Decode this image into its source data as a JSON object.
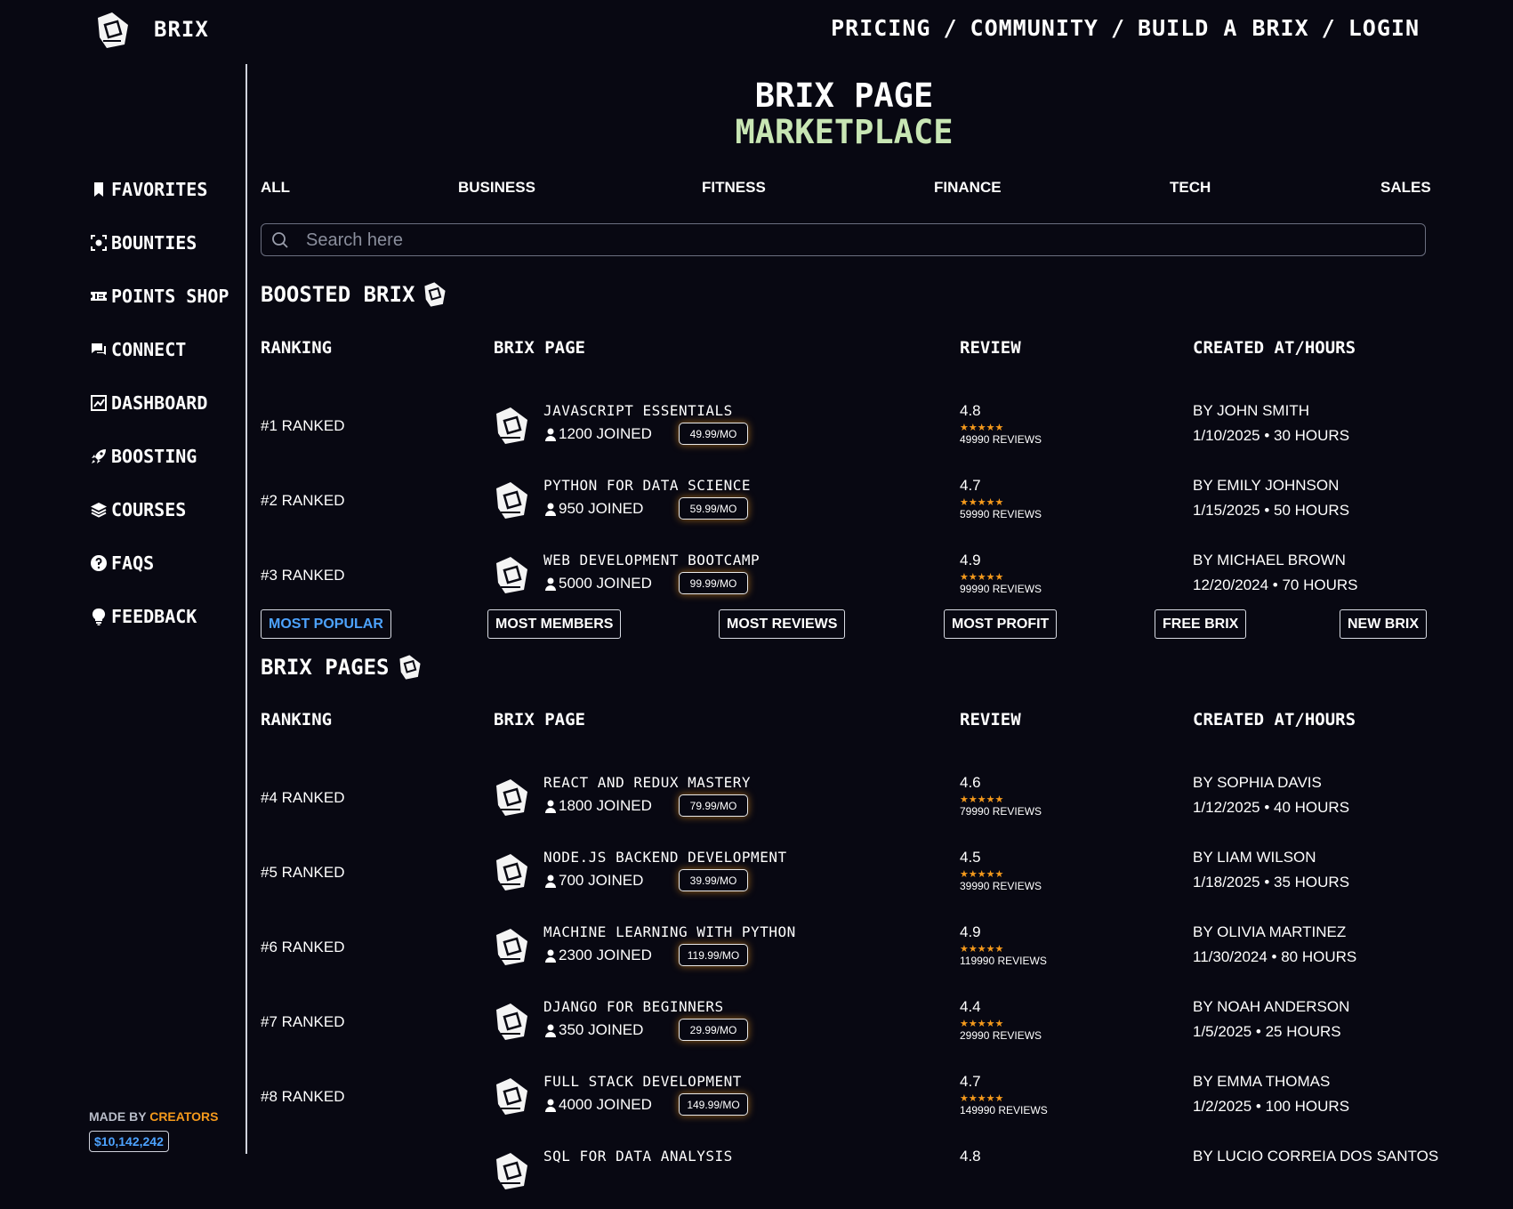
{
  "header": {
    "brand": "BRIX",
    "nav": [
      "PRICING",
      "COMMUNITY",
      "BUILD A BRIX",
      "LOGIN"
    ],
    "separator": "/"
  },
  "sidebar": {
    "items": [
      {
        "label": "FAVORITES",
        "icon": "bookmark-icon"
      },
      {
        "label": "BOUNTIES",
        "icon": "target-icon"
      },
      {
        "label": "POINTS SHOP",
        "icon": "ticket-icon"
      },
      {
        "label": "CONNECT",
        "icon": "chat-icon"
      },
      {
        "label": "DASHBOARD",
        "icon": "chart-icon"
      },
      {
        "label": "BOOSTING",
        "icon": "rocket-icon"
      },
      {
        "label": "COURSES",
        "icon": "layers-icon"
      },
      {
        "label": "FAQS",
        "icon": "question-icon"
      },
      {
        "label": "FEEDBACK",
        "icon": "lightbulb-icon"
      }
    ],
    "made_by_prefix": "MADE BY",
    "made_by_accent": "CREATORS",
    "total": "$10,142,242"
  },
  "page": {
    "title": "BRIX PAGE",
    "subtitle": "MARKETPLACE"
  },
  "tabs": [
    "ALL",
    "BUSINESS",
    "FITNESS",
    "FINANCE",
    "TECH",
    "SALES"
  ],
  "search": {
    "placeholder": "Search here",
    "value": ""
  },
  "columns": [
    "RANKING",
    "BRIX PAGE",
    "REVIEW",
    "CREATED AT/HOURS"
  ],
  "boosted": {
    "title": "BOOSTED BRIX",
    "rows": [
      {
        "rank": "#1 RANKED",
        "name": "JAVASCRIPT ESSENTIALS",
        "joined": "1200 JOINED",
        "price": "49.99/MO",
        "rating": "4.8",
        "stars": "★★★★★",
        "reviews": "49990 REVIEWS",
        "author": "BY JOHN SMITH",
        "created": "1/10/2025 • 30 HOURS"
      },
      {
        "rank": "#2 RANKED",
        "name": "PYTHON FOR DATA SCIENCE",
        "joined": "950 JOINED",
        "price": "59.99/MO",
        "rating": "4.7",
        "stars": "★★★★★",
        "reviews": "59990 REVIEWS",
        "author": "BY EMILY JOHNSON",
        "created": "1/15/2025 • 50 HOURS"
      },
      {
        "rank": "#3 RANKED",
        "name": "WEB DEVELOPMENT BOOTCAMP",
        "joined": "5000 JOINED",
        "price": "99.99/MO",
        "rating": "4.9",
        "stars": "★★★★★",
        "reviews": "99990 REVIEWS",
        "author": "BY MICHAEL BROWN",
        "created": "12/20/2024 • 70 HOURS"
      }
    ]
  },
  "filters": [
    "MOST POPULAR",
    "MOST MEMBERS",
    "MOST REVIEWS",
    "MOST PROFIT",
    "FREE BRIX",
    "NEW BRIX"
  ],
  "pages": {
    "title": "BRIX PAGES",
    "rows": [
      {
        "rank": "#4 RANKED",
        "name": "REACT AND REDUX MASTERY",
        "joined": "1800 JOINED",
        "price": "79.99/MO",
        "rating": "4.6",
        "stars": "★★★★★",
        "reviews": "79990 REVIEWS",
        "author": "BY SOPHIA DAVIS",
        "created": "1/12/2025 • 40 HOURS"
      },
      {
        "rank": "#5 RANKED",
        "name": "NODE.JS BACKEND DEVELOPMENT",
        "joined": "700 JOINED",
        "price": "39.99/MO",
        "rating": "4.5",
        "stars": "★★★★★",
        "reviews": "39990 REVIEWS",
        "author": "BY LIAM WILSON",
        "created": "1/18/2025 • 35 HOURS"
      },
      {
        "rank": "#6 RANKED",
        "name": "MACHINE LEARNING WITH PYTHON",
        "joined": "2300 JOINED",
        "price": "119.99/MO",
        "rating": "4.9",
        "stars": "★★★★★",
        "reviews": "119990 REVIEWS",
        "author": "BY OLIVIA MARTINEZ",
        "created": "11/30/2024 • 80 HOURS"
      },
      {
        "rank": "#7 RANKED",
        "name": "DJANGO FOR BEGINNERS",
        "joined": "350 JOINED",
        "price": "29.99/MO",
        "rating": "4.4",
        "stars": "★★★★★",
        "reviews": "29990 REVIEWS",
        "author": "BY NOAH ANDERSON",
        "created": "1/5/2025 • 25 HOURS"
      },
      {
        "rank": "#8 RANKED",
        "name": "FULL STACK DEVELOPMENT",
        "joined": "4000 JOINED",
        "price": "149.99/MO",
        "rating": "4.7",
        "stars": "★★★★★",
        "reviews": "149990 REVIEWS",
        "author": "BY EMMA THOMAS",
        "created": "1/2/2025 • 100 HOURS"
      },
      {
        "rank": "",
        "name": "SQL FOR DATA ANALYSIS",
        "joined": "",
        "price": "",
        "rating": "4.8",
        "stars": "",
        "reviews": "",
        "author": "BY LUCIO CORREIA DOS SANTOS",
        "created": ""
      }
    ]
  },
  "colors": {
    "accent_orange": "#f59a1c",
    "accent_blue": "#4da3ff",
    "subtitle_green": "#c8e6b4",
    "background": "#080812"
  }
}
